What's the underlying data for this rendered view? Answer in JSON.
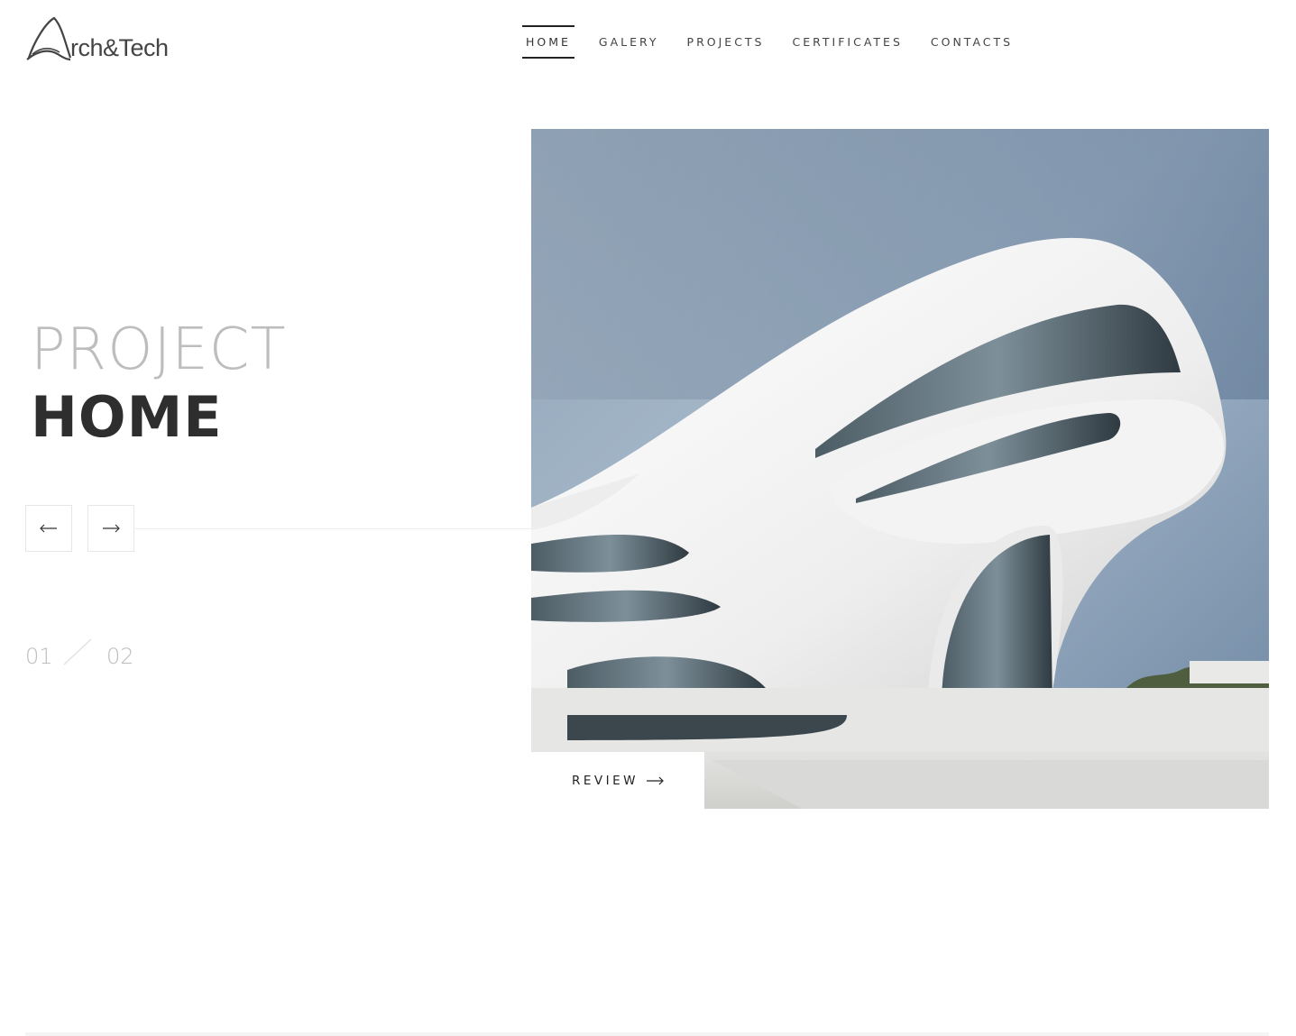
{
  "brand": {
    "logo_text": "rch&Tech",
    "logo_mark_letter": "A"
  },
  "nav": {
    "items": [
      {
        "label": "HOME",
        "active": true
      },
      {
        "label": "GALERY",
        "active": false
      },
      {
        "label": "PROJECTS",
        "active": false
      },
      {
        "label": "CERTIFICATES",
        "active": false
      },
      {
        "label": "CONTACTS",
        "active": false
      }
    ]
  },
  "hero": {
    "title_light": "PROJECT",
    "title_bold": "HOME",
    "image_subject": "futuristic-white-curved-building",
    "review_label": "REVIEW"
  },
  "slider": {
    "current": "01",
    "total": "02",
    "prev_icon": "arrow-left-icon",
    "next_icon": "arrow-right-icon"
  },
  "colors": {
    "background": "#ffffff",
    "text_dark": "#2e2e2e",
    "text_light": "#bdbdbd",
    "accent": "#222222"
  }
}
